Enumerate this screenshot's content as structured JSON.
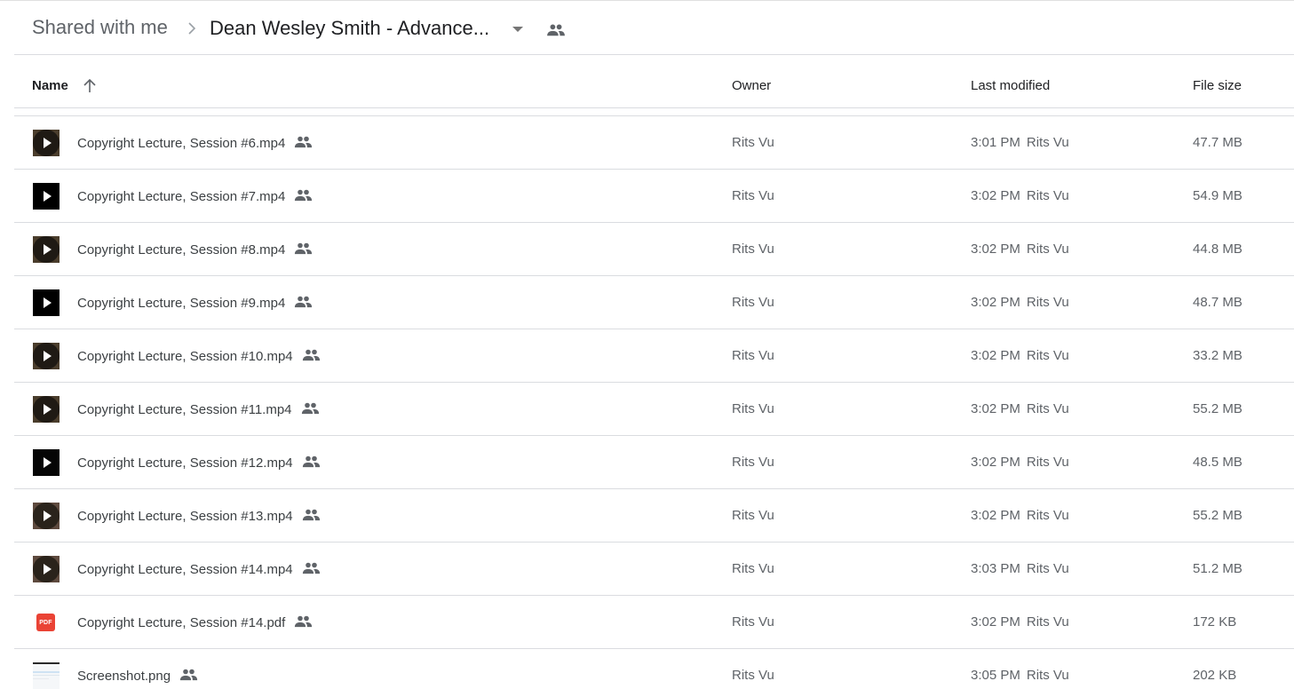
{
  "breadcrumb": {
    "root": "Shared with me",
    "current": "Dean Wesley Smith - Advance..."
  },
  "columns": {
    "name": "Name",
    "owner": "Owner",
    "last_modified": "Last modified",
    "file_size": "File size"
  },
  "sort": {
    "column": "name",
    "direction": "ascending",
    "icon": "arrow-upward-icon"
  },
  "files": [
    {
      "name": "Copyright Lecture, Session #6.mp4",
      "type": "video",
      "thumb_bg": "#4a3d2c",
      "thumb_disc": "#1f1a14",
      "owner": "Rits Vu",
      "modified_time": "3:01 PM",
      "modified_by": "Rits Vu",
      "size": "47.7 MB",
      "shared": true
    },
    {
      "name": "Copyright Lecture, Session #7.mp4",
      "type": "video",
      "thumb_bg": "#000000",
      "thumb_disc": "#000000",
      "owner": "Rits Vu",
      "modified_time": "3:02 PM",
      "modified_by": "Rits Vu",
      "size": "54.9 MB",
      "shared": true
    },
    {
      "name": "Copyright Lecture, Session #8.mp4",
      "type": "video",
      "thumb_bg": "#4a3d2c",
      "thumb_disc": "#1f1a14",
      "owner": "Rits Vu",
      "modified_time": "3:02 PM",
      "modified_by": "Rits Vu",
      "size": "44.8 MB",
      "shared": true
    },
    {
      "name": "Copyright Lecture, Session #9.mp4",
      "type": "video",
      "thumb_bg": "#000000",
      "thumb_disc": "#000000",
      "owner": "Rits Vu",
      "modified_time": "3:02 PM",
      "modified_by": "Rits Vu",
      "size": "48.7 MB",
      "shared": true
    },
    {
      "name": "Copyright Lecture, Session #10.mp4",
      "type": "video",
      "thumb_bg": "#4a3d2c",
      "thumb_disc": "#1f1a14",
      "owner": "Rits Vu",
      "modified_time": "3:02 PM",
      "modified_by": "Rits Vu",
      "size": "33.2 MB",
      "shared": true
    },
    {
      "name": "Copyright Lecture, Session #11.mp4",
      "type": "video",
      "thumb_bg": "#4a3d2c",
      "thumb_disc": "#1f1a14",
      "owner": "Rits Vu",
      "modified_time": "3:02 PM",
      "modified_by": "Rits Vu",
      "size": "55.2 MB",
      "shared": true
    },
    {
      "name": "Copyright Lecture, Session #12.mp4",
      "type": "video",
      "thumb_bg": "#050505",
      "thumb_disc": "#050505",
      "owner": "Rits Vu",
      "modified_time": "3:02 PM",
      "modified_by": "Rits Vu",
      "size": "48.5 MB",
      "shared": true
    },
    {
      "name": "Copyright Lecture, Session #13.mp4",
      "type": "video",
      "thumb_bg": "#5e4a3e",
      "thumb_disc": "#2a231b",
      "owner": "Rits Vu",
      "modified_time": "3:02 PM",
      "modified_by": "Rits Vu",
      "size": "55.2 MB",
      "shared": true
    },
    {
      "name": "Copyright Lecture, Session #14.mp4",
      "type": "video",
      "thumb_bg": "#5e4a3e",
      "thumb_disc": "#2a231b",
      "owner": "Rits Vu",
      "modified_time": "3:03 PM",
      "modified_by": "Rits Vu",
      "size": "51.2 MB",
      "shared": true
    },
    {
      "name": "Copyright Lecture, Session #14.pdf",
      "type": "pdf",
      "thumb_label": "PDF",
      "owner": "Rits Vu",
      "modified_time": "3:02 PM",
      "modified_by": "Rits Vu",
      "size": "172 KB",
      "shared": true
    },
    {
      "name": "Screenshot.png",
      "type": "image",
      "owner": "Rits Vu",
      "modified_time": "3:05 PM",
      "modified_by": "Rits Vu",
      "size": "202 KB",
      "shared": true
    }
  ],
  "colors": {
    "pdf_red": "#ea4335",
    "icon_gray": "#5f6368",
    "divider": "#dadce0"
  }
}
